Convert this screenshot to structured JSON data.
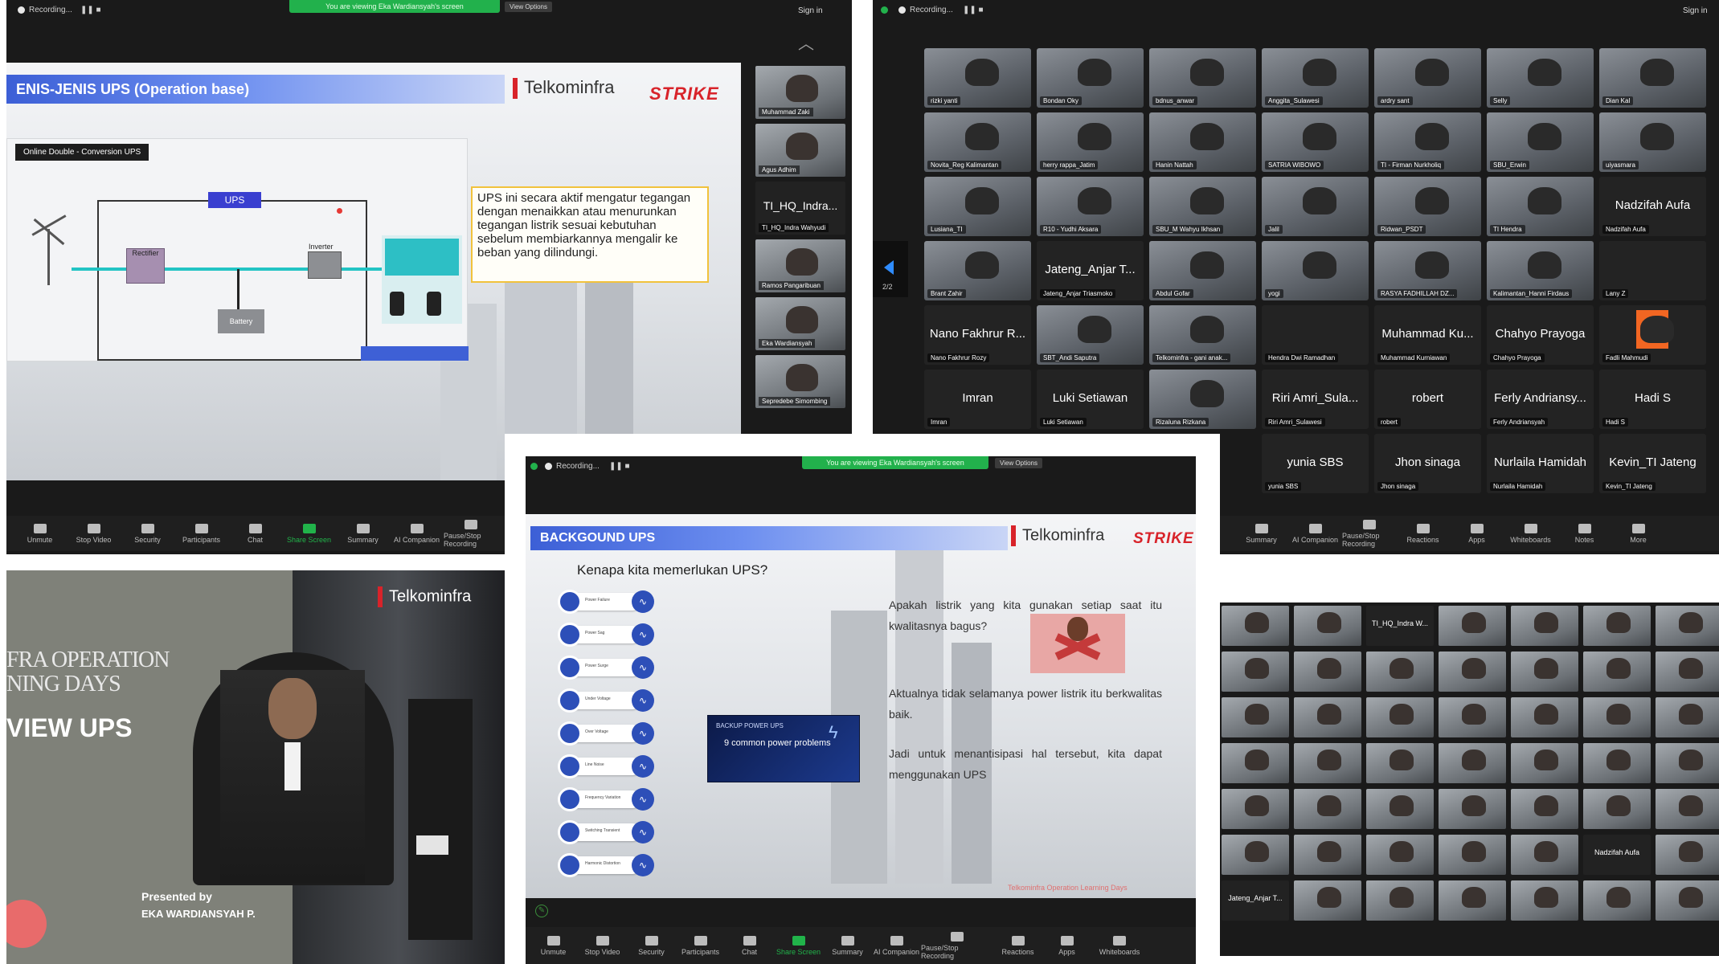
{
  "zoom": {
    "recording": "Recording...",
    "viewing_banner": "You are viewing Eka Wardiansyah's screen",
    "view_options": "View Options",
    "sign_in": "Sign in",
    "page_indicator": "2/2",
    "toolbar_a": [
      "Unmute",
      "Stop Video",
      "Security",
      "Participants",
      "Chat",
      "Share Screen",
      "Summary",
      "AI Companion",
      "Pause/Stop Recording"
    ],
    "toolbar_b": [
      "Summary",
      "AI Companion",
      "Pause/Stop Recording",
      "Reactions",
      "Apps",
      "Whiteboards",
      "Notes",
      "More"
    ],
    "toolbar_c": [
      "Unmute",
      "Stop Video",
      "Security",
      "Participants",
      "Chat",
      "Share Screen",
      "Summary",
      "AI Companion",
      "Pause/Stop Recording",
      "Reactions",
      "Apps",
      "Whiteboards"
    ]
  },
  "slide1": {
    "title": "ENIS-JENIS UPS (Operation base)",
    "telkom": "Telkominfra",
    "strike": "STRIKE",
    "diagram_label": "Online Double - Conversion UPS",
    "ups": "UPS",
    "rectifier": "Rectifier",
    "rectifier_sub": "AC\nDC",
    "inverter": "Inverter",
    "inverter_sub": "DC\nAC",
    "battery": "Battery",
    "callout": "UPS ini secara aktif mengatur tegangan dengan menaikkan atau menurunkan tegangan listrik sesuai kebutuhan sebelum membiarkannya mengalir ke beban yang dilindungi."
  },
  "sidebar_names": [
    "Muhammad Zaki",
    "Agus Adhim",
    "TI_HQ_Indra...",
    "TI_HQ_Indra Wahyudi",
    "Ramos Pangaribuan",
    "Eka Wardiansyah",
    "Sepredebe Simombing"
  ],
  "grid": [
    [
      "rizki yanti",
      "Bondan Oky",
      "bdnus_anwar",
      "Anggita_Sulawesi",
      "ardry sant",
      "Selly",
      "Dian Kal"
    ],
    [
      "Novita_Reg Kalimantan",
      "herry rappa_Jatim",
      "Hanin Nattah",
      "SATRIA WIBOWO",
      "TI - Firman Nurkholiq",
      "SBU_Erwin",
      "uiyasmara"
    ],
    [
      "Lusiana_TI",
      "R10 - Yudhi Aksara",
      "SBU_M Wahyu Ikhsan",
      "Jalil",
      "Ridwan_PSDT",
      "TI Hendra",
      "Nadzifah Aufa"
    ],
    [
      "Brant Zahir",
      "Jateng_Anjar Triasmoko",
      "Abdul Gofar",
      "yogi",
      "RASYA FADHILLAH DZ...",
      "Kalimantan_Hanni Firdaus",
      "Lany Z"
    ],
    [
      "Nano Fakhrur Rozy",
      "SBT_Andi Saputra",
      "Telkominfra - gani anak...",
      "Hendra Dwi Ramadhan",
      "Muhammad Kurniawan",
      "Chahyo Prayoga",
      "Fadli Mahmudi"
    ],
    [
      "Imran",
      "Luki Setiawan",
      "Rizaluna Rizkana",
      "Riri Amri_Sulawesi",
      "robert",
      "Ferly Andriansyah",
      "Hadi S"
    ],
    [
      "",
      "",
      "",
      "yunia SBS",
      "Jhon sinaga",
      "Nurlaila Hamidah",
      "Kevin_TI Jateng"
    ]
  ],
  "grid_bignames": {
    "r2c6": "Nadzifah Aufa",
    "r3c1": "Jateng_Anjar T...",
    "r4c0": "Nano Fakhrur R...",
    "r4c4": "Muhammad Ku...",
    "r4c5": "Chahyo Prayoga",
    "r5c0": "Imran",
    "r5c1": "Luki Setiawan",
    "r5c3": "Riri Amri_Sula...",
    "r5c4": "robert",
    "r5c5": "Ferly Andriansy...",
    "r5c6": "Hadi S",
    "r6c3": "yunia SBS",
    "r6c4": "Jhon sinaga",
    "r6c5": "Nurlaila Hamidah",
    "r6c6": "Kevin_TI Jateng"
  },
  "title_card": {
    "line1": "FRA OPERATION",
    "line2": "NING DAYS",
    "line3": "VIEW UPS",
    "presented_by": "Presented by",
    "presenter": "EKA WARDIANSYAH P.",
    "logo": "Telkominfra"
  },
  "slide2": {
    "title": "BACKGOUND UPS",
    "telkom": "Telkominfra",
    "strike": "STRIKE",
    "question": "Kenapa kita memerlukan UPS?",
    "problems": [
      "Power Failure",
      "Power Sag",
      "Power Surge",
      "Under Voltage",
      "Over Voltage",
      "Line Noise",
      "Frequency Variation",
      "Switching Transient",
      "Harmonic Distortion"
    ],
    "center_label_small": "BACKUP POWER UPS",
    "center_label": "9 common power problems",
    "p1": "Apakah listrik yang kita gunakan setiap saat itu kwalitasnya bagus?",
    "p2": "Aktualnya tidak selamanya power listrik itu berkwalitas baik.",
    "p3": "Jadi untuk menantisipasi hal tersebut, kita dapat menggunakan UPS",
    "footer": "Telkominfra Operation Learning Days"
  },
  "gallery_labels": {
    "tile1": "TI_HQ_Indra W...",
    "tile2": "Nadzifah Aufa",
    "tile3": "Jateng_Anjar T..."
  },
  "colors": {
    "zoom_green": "#22b14c",
    "slide_blue": "#3c5fd6",
    "brand_red": "#d8232a",
    "fb_orange": "#f26622"
  }
}
